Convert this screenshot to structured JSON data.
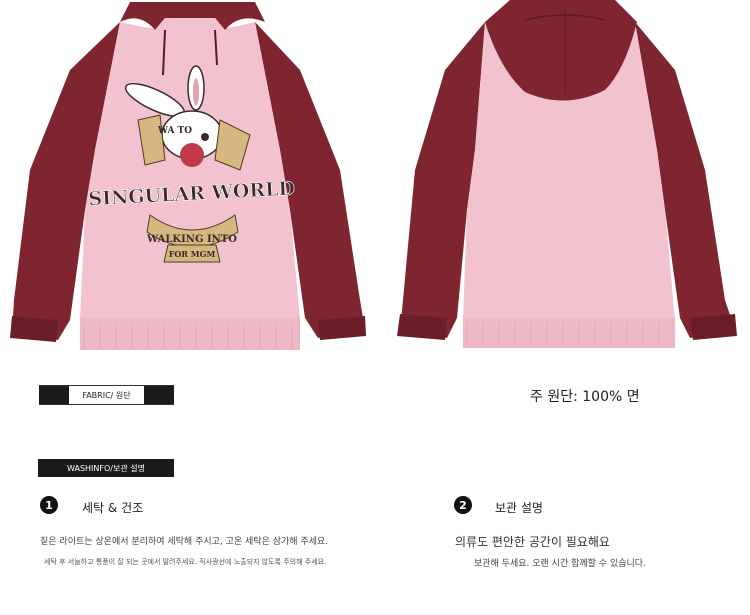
{
  "products": {
    "front_image": "hoodie-front",
    "back_image": "hoodie-back",
    "print": {
      "top_banner": "WA TO",
      "main_text": "SINGULAR WORLD",
      "middle_banner": "WALKING INTO",
      "bottom_banner": "FOR MGM"
    },
    "colors": {
      "body": "#f2c3cf",
      "sleeve": "#7e2530",
      "cuff": "#efb8c6"
    }
  },
  "fabric": {
    "tag_label": "FABRIC/ 원단",
    "material": "주 원단: 100% 면"
  },
  "wash": {
    "tag_label": "WASHINFO/보관 설명",
    "steps": [
      {
        "number": "1",
        "title": "세탁 & 건조",
        "text": "짙은 라이트는 상온에서 분리하여 세탁해 주시고, 고온 세탁은 삼가해 주세요.",
        "sub": "세탁 후 서늘하고 통풍이 잘 되는 곳에서 말려주세요. 직사광선에 노출되지 않도록 주의해 주세요."
      },
      {
        "number": "2",
        "title": "보관 설명",
        "text": "의류도 편안한 공간이 필요해요",
        "sub": "보관해 두세요. 오랜 시간 함께할 수 있습니다."
      }
    ]
  }
}
